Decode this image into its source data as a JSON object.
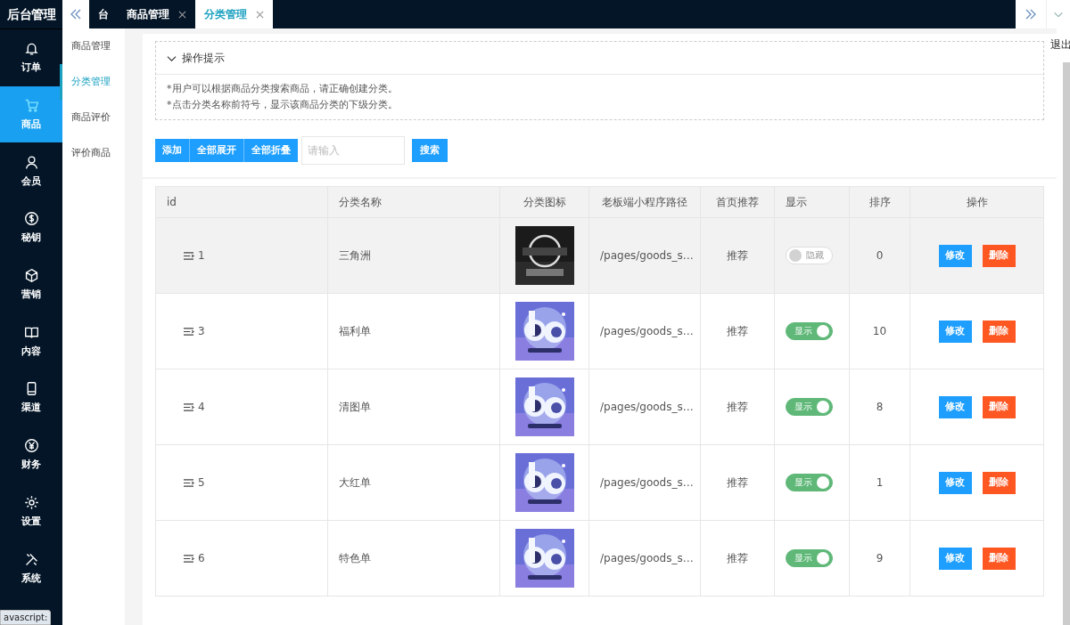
{
  "app_title": "后台管理",
  "nav": [
    {
      "label": "订单",
      "selected": false
    },
    {
      "label": "商品",
      "selected": true
    },
    {
      "label": "会员",
      "selected": false
    },
    {
      "label": "秘钥",
      "selected": false
    },
    {
      "label": "营销",
      "selected": false
    },
    {
      "label": "内容",
      "selected": false
    },
    {
      "label": "渠道",
      "selected": false
    },
    {
      "label": "财务",
      "selected": false
    },
    {
      "label": "设置",
      "selected": false
    },
    {
      "label": "系统",
      "selected": false
    }
  ],
  "tabs": [
    {
      "label": "台",
      "closable": false,
      "selected": false
    },
    {
      "label": "商品管理",
      "closable": true,
      "selected": false
    },
    {
      "label": "分类管理",
      "closable": true,
      "selected": true
    }
  ],
  "submenu": [
    {
      "label": "商品管理",
      "selected": false
    },
    {
      "label": "分类管理",
      "selected": true
    },
    {
      "label": "商品评价",
      "selected": false
    },
    {
      "label": "评价商品",
      "selected": false
    }
  ],
  "logout": "退出",
  "tips": {
    "title": "操作提示",
    "expanded": true,
    "lines": [
      "*用户可以根据商品分类搜索商品，请正确创建分类。",
      "*点击分类名称前符号，显示该商品分类的下级分类。"
    ]
  },
  "toolbar": {
    "buttons": [
      "添加",
      "全部展开",
      "全部折叠"
    ],
    "search": {
      "placeholder": "请输入"
    },
    "search_button": "搜索"
  },
  "table": {
    "columns": [
      "id",
      "分类名称",
      "分类图标",
      "老板端小程序路径",
      "首页推荐",
      "显示",
      "排序",
      "操作"
    ],
    "rows": [
      {
        "id": "1",
        "name": "三角洲",
        "icon": {
          "kind": "picture"
        },
        "path": "/pages/goods_s…",
        "recommend": "推荐",
        "display": {
          "on": false,
          "label": "隐藏"
        },
        "sort": "0",
        "actions": [
          "修改",
          "删除"
        ],
        "selected": true
      },
      {
        "id": "3",
        "name": "福利单",
        "icon": {
          "kind": "picture"
        },
        "path": "/pages/goods_s…",
        "recommend": "推荐",
        "display": {
          "on": true,
          "label": "显示"
        },
        "sort": "10",
        "actions": [
          "修改",
          "删除"
        ],
        "selected": false
      },
      {
        "id": "4",
        "name": "清图单",
        "icon": {
          "kind": "picture"
        },
        "path": "/pages/goods_s…",
        "recommend": "推荐",
        "display": {
          "on": true,
          "label": "显示"
        },
        "sort": "8",
        "actions": [
          "修改",
          "删除"
        ],
        "selected": false
      },
      {
        "id": "5",
        "name": "大红单",
        "icon": {
          "kind": "picture"
        },
        "path": "/pages/goods_s…",
        "recommend": "推荐",
        "display": {
          "on": true,
          "label": "显示"
        },
        "sort": "1",
        "actions": [
          "修改",
          "删除"
        ],
        "selected": false
      },
      {
        "id": "6",
        "name": "特色单",
        "icon": {
          "kind": "picture"
        },
        "path": "/pages/goods_s…",
        "recommend": "推荐",
        "display": {
          "on": true,
          "label": "显示"
        },
        "sort": "9",
        "actions": [
          "修改",
          "删除"
        ],
        "selected": false
      }
    ]
  },
  "status_text": "avascript:"
}
